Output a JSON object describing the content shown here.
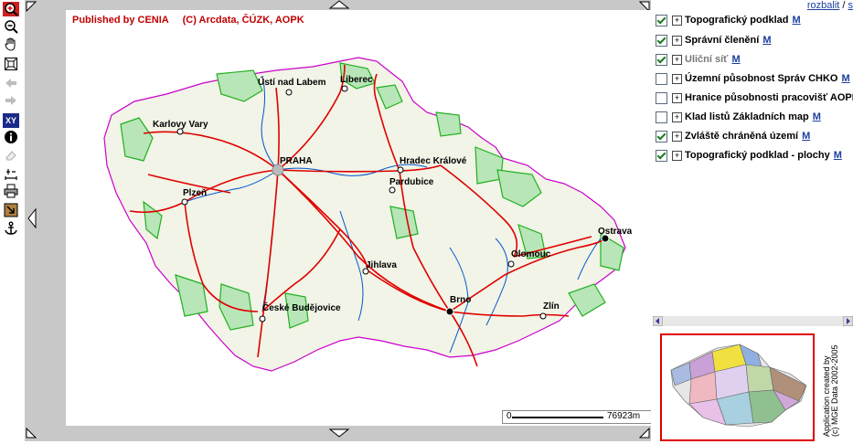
{
  "toolbar": {
    "tools": [
      {
        "icon": "zoom-in-icon"
      },
      {
        "icon": "zoom-out-icon"
      },
      {
        "icon": "pan-hand-icon"
      },
      {
        "icon": "zoom-extent-icon"
      },
      {
        "icon": "back-arrow-icon"
      },
      {
        "icon": "forward-arrow-icon"
      },
      {
        "icon": "coordinates-xy-icon",
        "label": "XY"
      },
      {
        "icon": "info-icon"
      },
      {
        "icon": "eraser-icon"
      },
      {
        "icon": "measure-icon"
      },
      {
        "icon": "print-icon"
      },
      {
        "icon": "export-icon"
      },
      {
        "icon": "anchor-icon"
      }
    ]
  },
  "map": {
    "copyright": "Published by CENIA     (C) Arcdata, ČÚZK, AOPK",
    "scale_label": "76923m",
    "scale_zero": "0",
    "cities": [
      "Ústí nad Labem",
      "Liberec",
      "Karlovy Vary",
      "PRAHA",
      "Hradec Králové",
      "Pardubice",
      "Plzeň",
      "Ostrava",
      "Olomouc",
      "Jihlava",
      "Brno",
      "Zlín",
      "České Budějovice"
    ]
  },
  "layers": {
    "links": {
      "expand": "rozbalit",
      "sep": " / ",
      "collapse": "s"
    },
    "items": [
      {
        "label": "Topografický podklad",
        "checked": true,
        "meta": "M"
      },
      {
        "label": "Správní členění",
        "checked": true,
        "meta": "M"
      },
      {
        "label": "Uliční síť",
        "checked": true,
        "meta": "M"
      },
      {
        "label": "Územní působnost Správ CHKO",
        "checked": false,
        "meta": "M"
      },
      {
        "label": "Hranice působnosti pracovišť AOPK",
        "checked": false,
        "meta": "M"
      },
      {
        "label": "Klad listů Základních map",
        "checked": false,
        "meta": "M"
      },
      {
        "label": "Zvláště chráněná území",
        "checked": true,
        "meta": "M"
      },
      {
        "label": "Topografický podklad - plochy",
        "checked": true,
        "meta": "M"
      }
    ]
  },
  "credits": {
    "line1": "Application created by",
    "line2": "(c) MGE Data 2002-2005"
  },
  "colors": {
    "roads": "#e00000",
    "border": "#cc00cc",
    "rivers": "#0055cc",
    "protected": "#20b020",
    "accent": "#c00000"
  }
}
